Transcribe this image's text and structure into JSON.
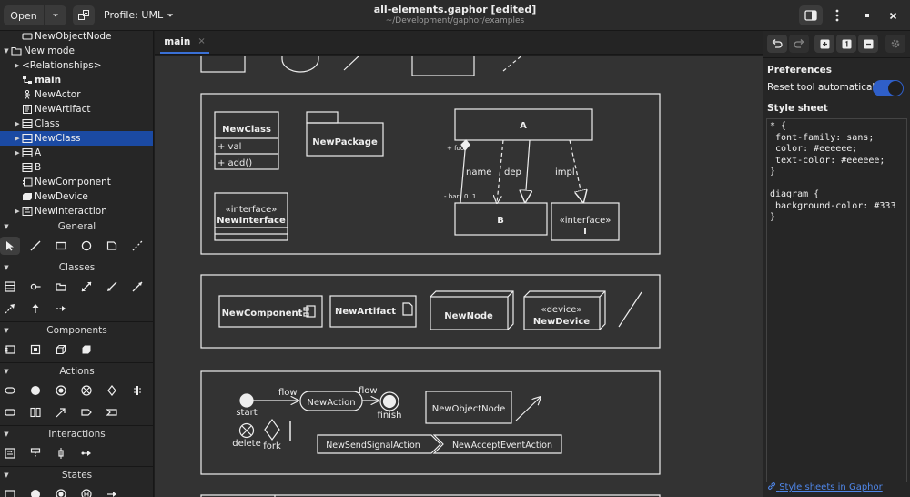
{
  "header": {
    "open_label": "Open",
    "profile_label": "Profile: UML",
    "title": "all-elements.gaphor [edited]",
    "subtitle": "~/Development/gaphor/examples"
  },
  "tree": [
    {
      "label": "NewObjectNode",
      "icon": "object-node-icon",
      "indent": 1,
      "twisty": ""
    },
    {
      "label": "New model",
      "icon": "package-icon",
      "indent": 0,
      "twisty": "▼"
    },
    {
      "label": "<Relationships>",
      "icon": "",
      "indent": 1,
      "twisty": "▶"
    },
    {
      "label": "main",
      "icon": "diagram-icon",
      "indent": 1,
      "twisty": "",
      "bold": true
    },
    {
      "label": "NewActor",
      "icon": "actor-icon",
      "indent": 1,
      "twisty": ""
    },
    {
      "label": "NewArtifact",
      "icon": "artifact-icon",
      "indent": 1,
      "twisty": ""
    },
    {
      "label": "Class",
      "icon": "class-icon",
      "indent": 1,
      "twisty": "▶"
    },
    {
      "label": "NewClass",
      "icon": "class-icon",
      "indent": 1,
      "twisty": "▶",
      "selected": true
    },
    {
      "label": "A",
      "icon": "class-icon",
      "indent": 1,
      "twisty": "▶"
    },
    {
      "label": "B",
      "icon": "class-icon",
      "indent": 1,
      "twisty": ""
    },
    {
      "label": "NewComponent",
      "icon": "component-icon",
      "indent": 1,
      "twisty": ""
    },
    {
      "label": "NewDevice",
      "icon": "device-icon",
      "indent": 1,
      "twisty": ""
    },
    {
      "label": "NewInteraction",
      "icon": "interaction-icon",
      "indent": 1,
      "twisty": "▶"
    }
  ],
  "toolbox": {
    "general": "General",
    "classes": "Classes",
    "components": "Components",
    "actions": "Actions",
    "interactions": "Interactions",
    "states": "States"
  },
  "tab": {
    "label": "main",
    "close": "×"
  },
  "diagram": {
    "class1": {
      "name": "NewClass",
      "attr": "+ val",
      "op": "+ add()"
    },
    "package1": {
      "name": "NewPackage"
    },
    "interface1": {
      "stereo": "«interface»",
      "name": "NewInterface"
    },
    "classA": {
      "name": "A"
    },
    "classB": {
      "name": "B"
    },
    "interface2": {
      "stereo": "«interface»",
      "name": "I"
    },
    "lbl_foo": "+ foo",
    "lbl_bar": "- bar",
    "lbl_mult": "0..1",
    "lbl_name": "name",
    "lbl_dep": "dep",
    "lbl_impl": "impl",
    "component": "NewComponent",
    "artifact": "NewArtifact",
    "node": "NewNode",
    "device_stereo": "«device»",
    "device": "NewDevice",
    "start": "start",
    "flow1": "flow",
    "action": "NewAction",
    "flow2": "flow",
    "finish": "finish",
    "object_node": "NewObjectNode",
    "delete": "delete",
    "fork": "fork",
    "send_signal": "NewSendSignalAction",
    "accept_event": "NewAcceptEventAction"
  },
  "right_panel": {
    "preferences": "Preferences",
    "reset_tool": "Reset tool automatically",
    "reset_tool_enabled": true,
    "style_sheet": "Style sheet",
    "css": "* {\n font-family: sans;\n color: #eeeeee;\n text-color: #eeeeee;\n}\n\ndiagram {\n background-color: #333\n}",
    "link": "Style sheets in Gaphor"
  },
  "colors": {
    "accent": "#3a70d6",
    "selection": "#1b4aa3",
    "canvas": "#333333",
    "link": "#4f86e8"
  }
}
